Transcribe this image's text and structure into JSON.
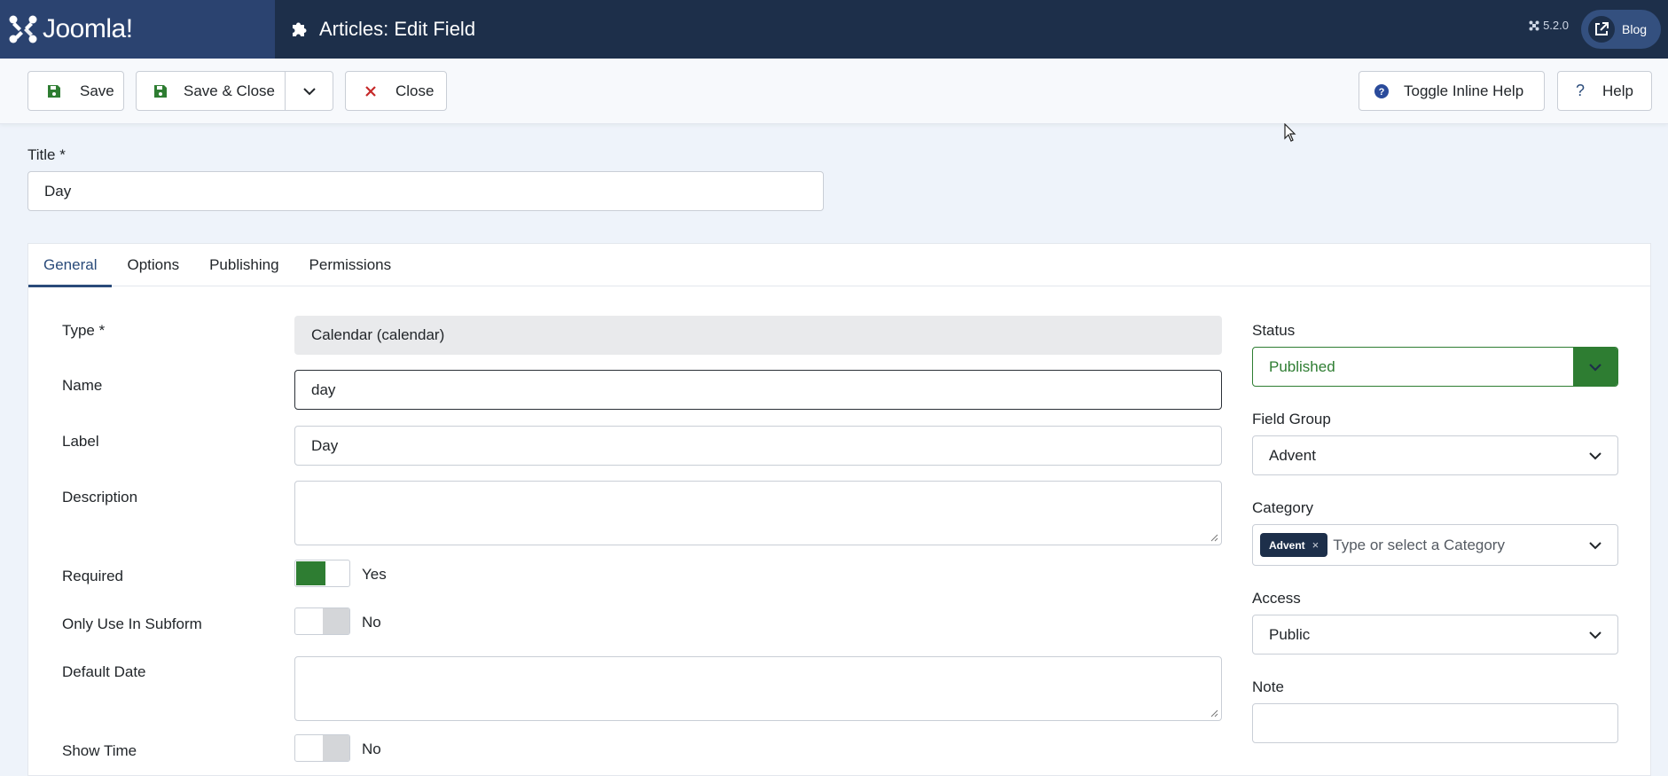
{
  "header": {
    "logo_text": "Joomla!",
    "page_title": "Articles: Edit Field",
    "version": "5.2.0",
    "site_link_label": "Blog"
  },
  "toolbar": {
    "save_label": "Save",
    "save_close_label": "Save & Close",
    "close_label": "Close",
    "toggle_help_label": "Toggle Inline Help",
    "help_label": "Help"
  },
  "title_field": {
    "label": "Title *",
    "value": "Day"
  },
  "tabs": [
    {
      "label": "General",
      "active": true
    },
    {
      "label": "Options",
      "active": false
    },
    {
      "label": "Publishing",
      "active": false
    },
    {
      "label": "Permissions",
      "active": false
    }
  ],
  "general": {
    "type": {
      "label": "Type *",
      "value": "Calendar (calendar)"
    },
    "name": {
      "label": "Name",
      "value": "day"
    },
    "field_label": {
      "label": "Label",
      "value": "Day"
    },
    "description": {
      "label": "Description",
      "value": ""
    },
    "required": {
      "label": "Required",
      "value": "Yes",
      "on": true
    },
    "only_use_in_subform": {
      "label": "Only Use In Subform",
      "value": "No",
      "on": false
    },
    "default_date": {
      "label": "Default Date",
      "value": ""
    },
    "show_time": {
      "label": "Show Time",
      "value": "No",
      "on": false
    }
  },
  "sidebar": {
    "status": {
      "label": "Status",
      "value": "Published"
    },
    "field_group": {
      "label": "Field Group",
      "value": "Advent"
    },
    "category": {
      "label": "Category",
      "tag": "Advent",
      "tag_remove": "×",
      "placeholder": "Type or select a Category"
    },
    "access": {
      "label": "Access",
      "value": "Public"
    },
    "note": {
      "label": "Note",
      "value": ""
    }
  },
  "colors": {
    "header_bg": "#1d2f4a",
    "logo_bg": "#2b4370",
    "success": "#2e7d32",
    "accent": "#2a4b7a"
  }
}
